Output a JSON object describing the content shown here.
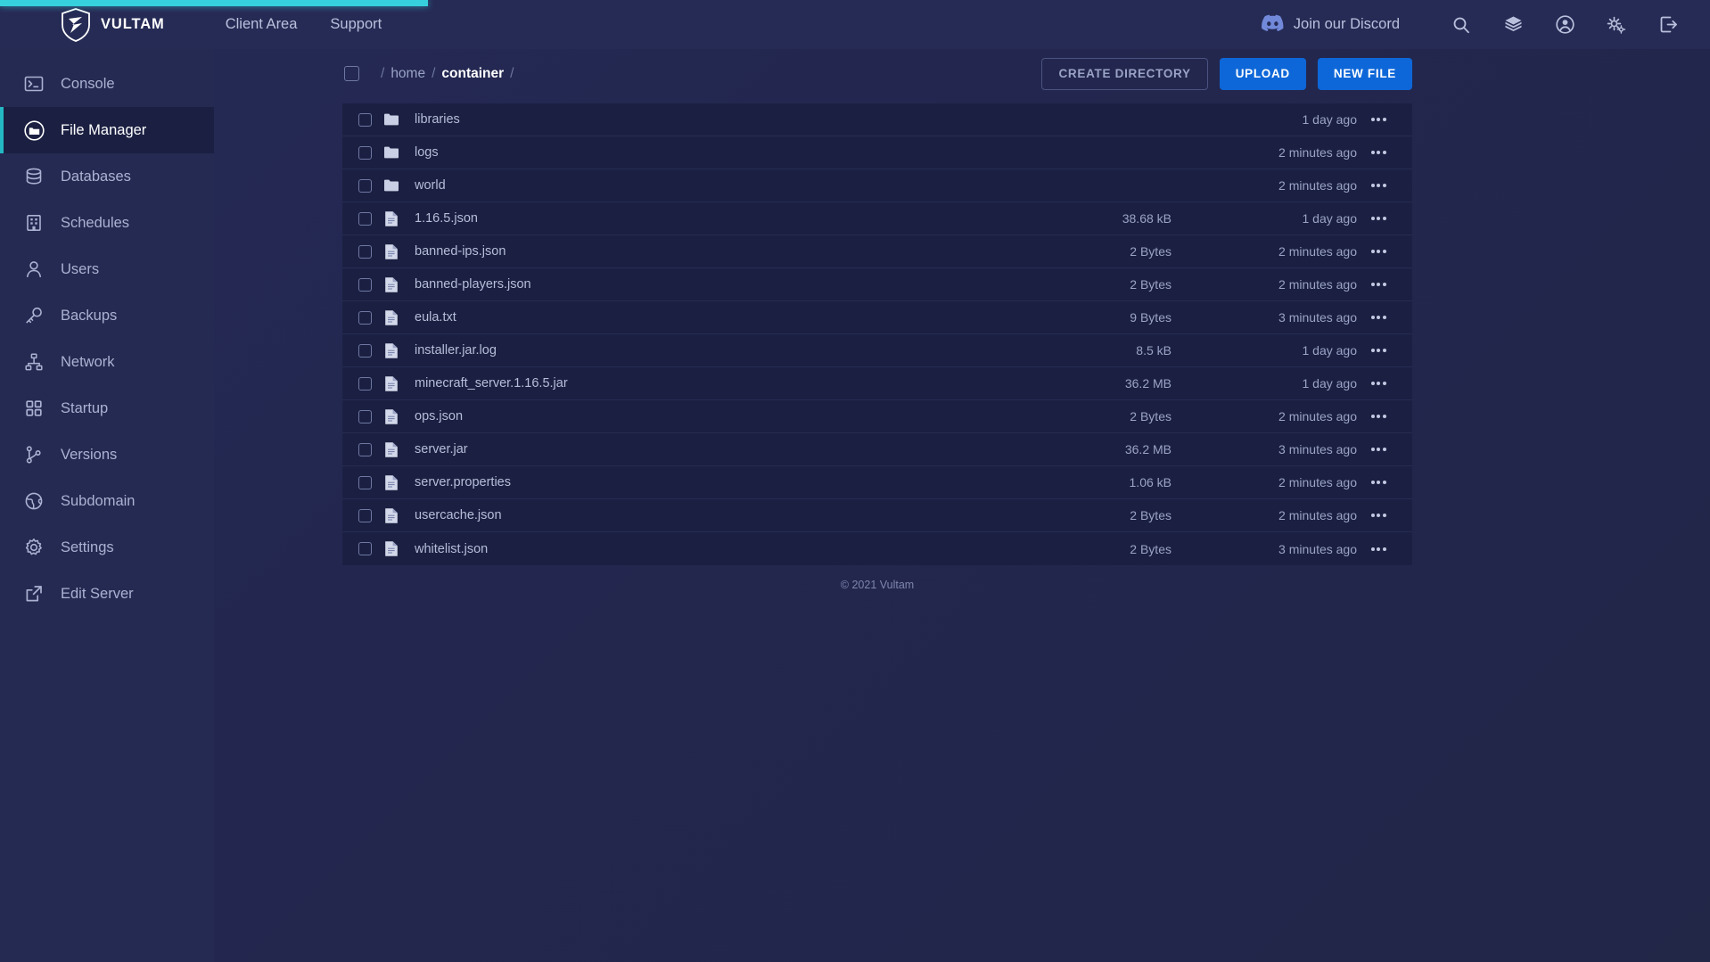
{
  "progress": {
    "percent": 25,
    "color": "#36d1dc"
  },
  "navbar": {
    "brand": "VULTAM",
    "brand_icon": "shield-logo-icon",
    "links": [
      {
        "label": "Client Area",
        "name": "client-area"
      },
      {
        "label": "Support",
        "name": "support"
      }
    ],
    "discord": {
      "label": "Join our Discord",
      "icon": "discord-icon"
    },
    "icons": [
      {
        "name": "search-icon"
      },
      {
        "name": "layers-icon"
      },
      {
        "name": "account-circle-icon"
      },
      {
        "name": "gears-icon"
      },
      {
        "name": "logout-icon"
      }
    ]
  },
  "sidebar": {
    "items": [
      {
        "label": "Console",
        "icon": "terminal-icon",
        "active": false
      },
      {
        "label": "File Manager",
        "icon": "folder-circle-icon",
        "active": true
      },
      {
        "label": "Databases",
        "icon": "database-icon",
        "active": false
      },
      {
        "label": "Schedules",
        "icon": "building-icon",
        "active": false
      },
      {
        "label": "Users",
        "icon": "user-icon",
        "active": false
      },
      {
        "label": "Backups",
        "icon": "key-icon",
        "active": false
      },
      {
        "label": "Network",
        "icon": "network-icon",
        "active": false
      },
      {
        "label": "Startup",
        "icon": "grid-icon",
        "active": false
      },
      {
        "label": "Versions",
        "icon": "git-branch-icon",
        "active": false
      },
      {
        "label": "Subdomain",
        "icon": "globe-icon",
        "active": false
      },
      {
        "label": "Settings",
        "icon": "gear-icon",
        "active": false
      },
      {
        "label": "Edit Server",
        "icon": "external-link-icon",
        "active": false
      }
    ]
  },
  "filemanager": {
    "breadcrumb": {
      "root": "/",
      "parts": [
        "home",
        "container"
      ],
      "trailing": "/"
    },
    "buttons": {
      "create_directory": "CREATE DIRECTORY",
      "upload": "UPLOAD",
      "new_file": "NEW FILE"
    },
    "rows": [
      {
        "name": "libraries",
        "type": "folder",
        "size": "",
        "modified": "1 day ago"
      },
      {
        "name": "logs",
        "type": "folder",
        "size": "",
        "modified": "2 minutes ago"
      },
      {
        "name": "world",
        "type": "folder",
        "size": "",
        "modified": "2 minutes ago"
      },
      {
        "name": "1.16.5.json",
        "type": "file",
        "size": "38.68 kB",
        "modified": "1 day ago"
      },
      {
        "name": "banned-ips.json",
        "type": "file",
        "size": "2 Bytes",
        "modified": "2 minutes ago"
      },
      {
        "name": "banned-players.json",
        "type": "file",
        "size": "2 Bytes",
        "modified": "2 minutes ago"
      },
      {
        "name": "eula.txt",
        "type": "file",
        "size": "9 Bytes",
        "modified": "3 minutes ago"
      },
      {
        "name": "installer.jar.log",
        "type": "file",
        "size": "8.5 kB",
        "modified": "1 day ago"
      },
      {
        "name": "minecraft_server.1.16.5.jar",
        "type": "file",
        "size": "36.2 MB",
        "modified": "1 day ago"
      },
      {
        "name": "ops.json",
        "type": "file",
        "size": "2 Bytes",
        "modified": "2 minutes ago"
      },
      {
        "name": "server.jar",
        "type": "file",
        "size": "36.2 MB",
        "modified": "3 minutes ago"
      },
      {
        "name": "server.properties",
        "type": "file",
        "size": "1.06 kB",
        "modified": "2 minutes ago"
      },
      {
        "name": "usercache.json",
        "type": "file",
        "size": "2 Bytes",
        "modified": "2 minutes ago"
      },
      {
        "name": "whitelist.json",
        "type": "file",
        "size": "2 Bytes",
        "modified": "3 minutes ago"
      }
    ],
    "footer": "© 2021 Vultam"
  },
  "colors": {
    "accent_teal": "#24b8c4",
    "primary_blue": "#0e67d8",
    "page_bg": "#232750",
    "sidebar_bg": "#252a52",
    "row_bg": "#1b2042"
  }
}
